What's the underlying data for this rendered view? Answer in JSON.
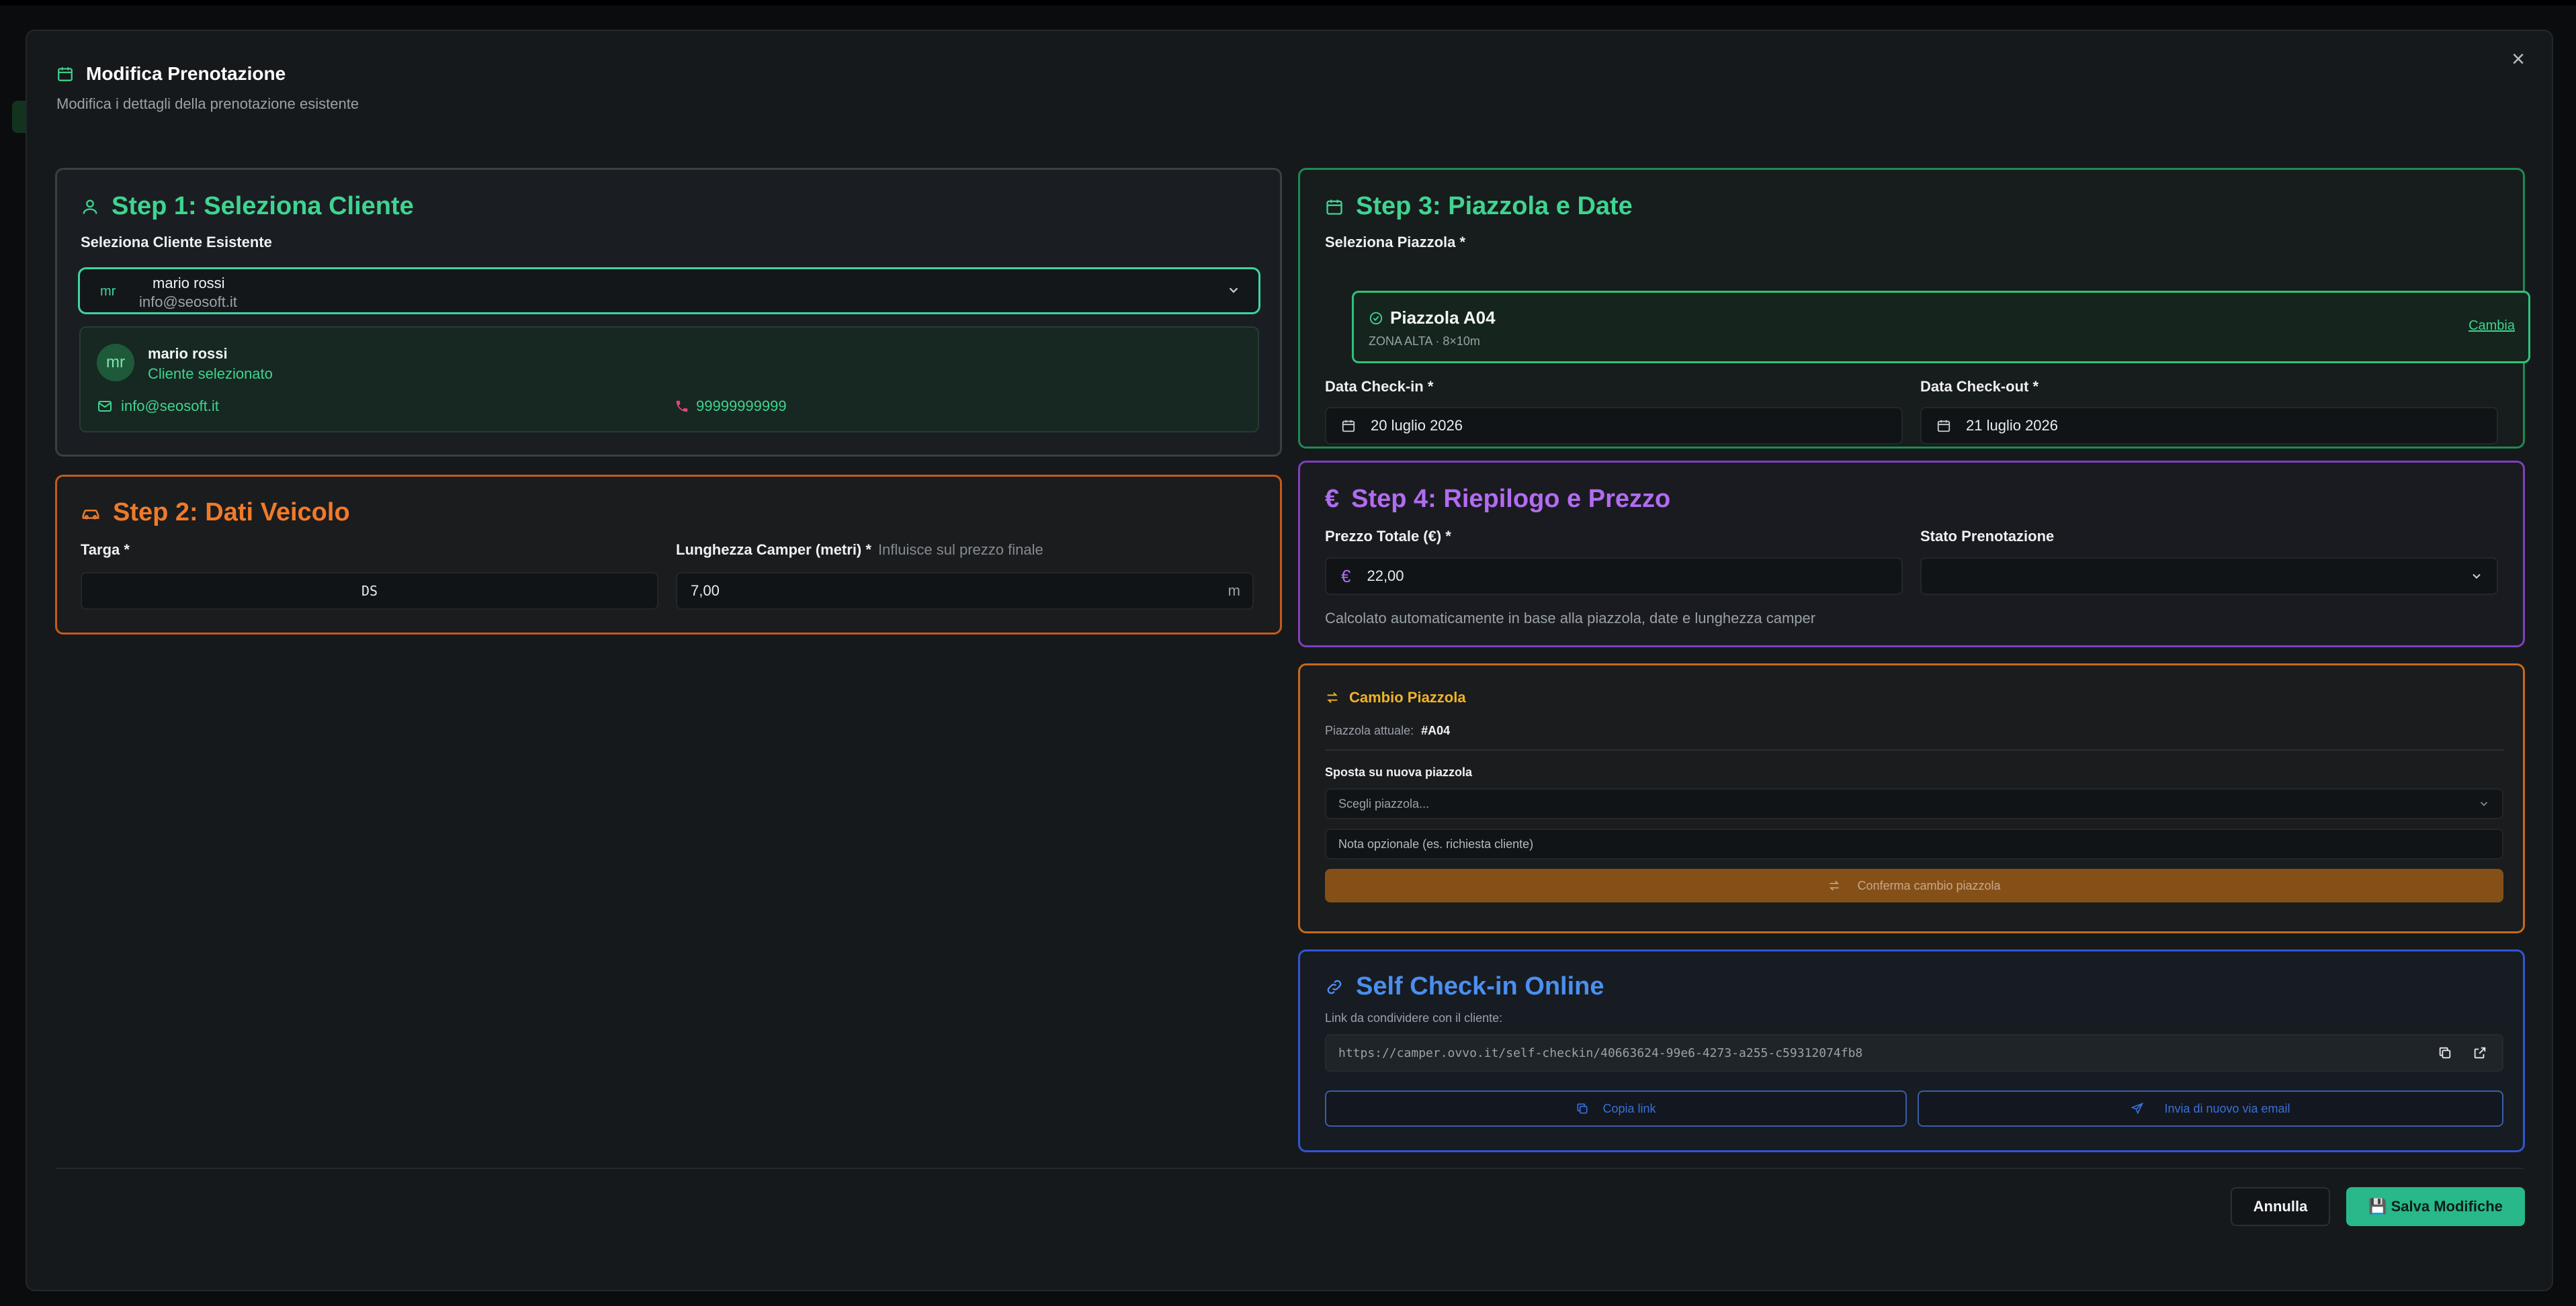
{
  "modal": {
    "title": "Modifica Prenotazione",
    "subtitle": "Modifica i dettagli della prenotazione esistente",
    "close_glyph": "×"
  },
  "step1": {
    "title": "Step 1: Seleziona Cliente",
    "select_label": "Seleziona Cliente Esistente",
    "selected": {
      "initials": "mr",
      "name": "mario rossi",
      "email": "info@seosoft.it"
    },
    "card": {
      "initials": "mr",
      "name": "mario rossi",
      "status": "Cliente selezionato",
      "email": "info@seosoft.it",
      "phone": "99999999999"
    }
  },
  "step2": {
    "title": "Step 2: Dati Veicolo",
    "plate_label": "Targa *",
    "plate_value": "DS",
    "length_label": "Lunghezza Camper (metri) *",
    "length_hint": "Influisce sul prezzo finale",
    "length_value": "7,00",
    "length_unit": "m"
  },
  "step3": {
    "title": "Step 3: Piazzola e Date",
    "pitch_label": "Seleziona Piazzola *",
    "pitch_name": "Piazzola A04",
    "pitch_sub": "ZONA ALTA · 8×10m",
    "pitch_change": "Cambia",
    "checkin_label": "Data Check-in *",
    "checkin_value": "20 luglio 2026",
    "checkout_label": "Data Check-out *",
    "checkout_value": "21 luglio 2026"
  },
  "step4": {
    "title": "Step 4: Riepilogo e Prezzo",
    "price_label": "Prezzo Totale (€) *",
    "price_value": "22,00",
    "currency_symbol": "€",
    "status_label": "Stato Prenotazione",
    "status_value": "",
    "help": "Calcolato automaticamente in base alla piazzola, date e lunghezza camper"
  },
  "pitch_change": {
    "title": "Cambio Piazzola",
    "current_label": "Piazzola attuale:",
    "current_value": "#A04",
    "move_label": "Sposta su nuova piazzola",
    "select_placeholder": "Scegli piazzola...",
    "note_placeholder": "Nota opzionale (es. richiesta cliente)",
    "confirm_label": "Conferma cambio piazzola"
  },
  "self_checkin": {
    "title": "Self Check-in Online",
    "link_label": "Link da condividere con il cliente:",
    "link_value": "https://camper.ovvo.it/self-checkin/40663624-99e6-4273-a255-c59312074fb8",
    "copy_label": "Copia link",
    "email_label": "Invia di nuovo via email"
  },
  "footer": {
    "cancel_label": "Annulla",
    "save_label": "💾 Salva Modifiche"
  },
  "colors": {
    "green": "#3fd490",
    "orange": "#f07a2a",
    "purple": "#b26cf0",
    "blue": "#4a8ff0",
    "amber": "#f0b429",
    "save": "#28b889"
  }
}
